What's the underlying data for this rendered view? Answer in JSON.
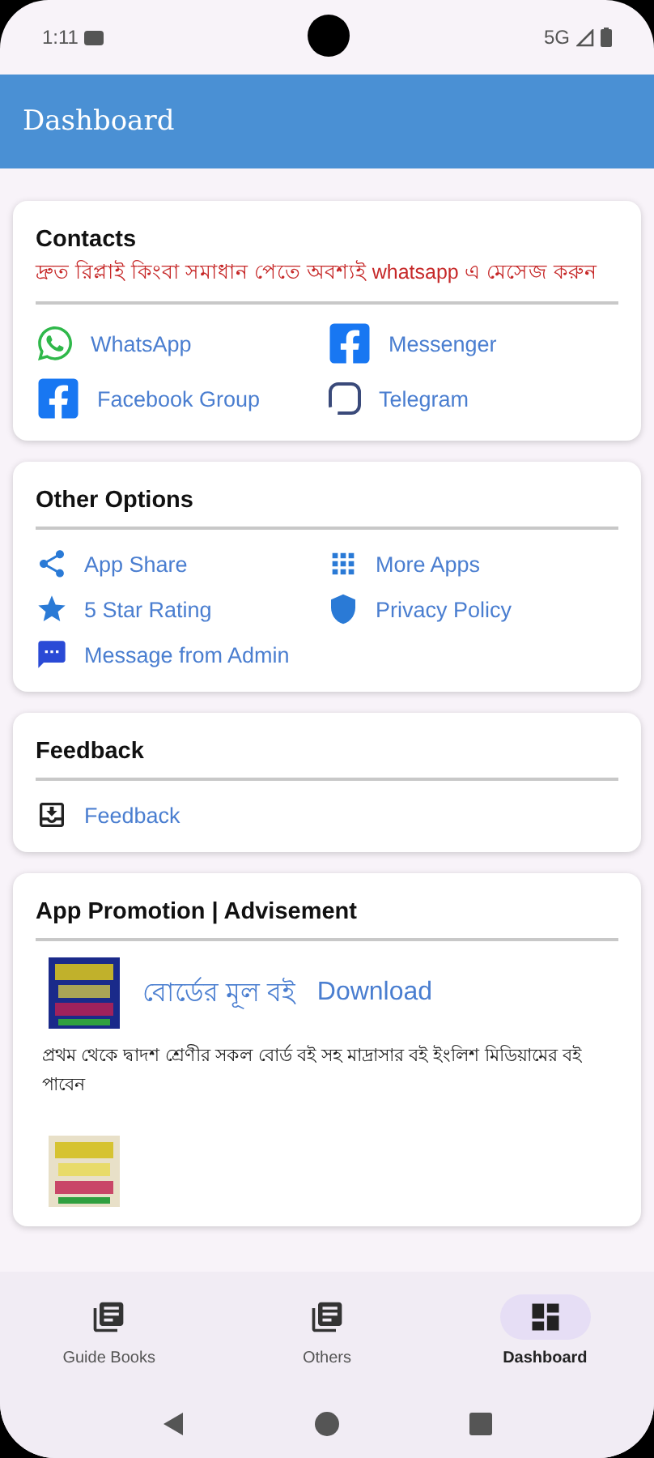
{
  "status_bar": {
    "time": "1:11",
    "network": "5G"
  },
  "app_bar": {
    "title": "Dashboard"
  },
  "contacts": {
    "title": "Contacts",
    "note": "দ্রুত রিপ্লাই কিংবা সমাধান পেতে অবশ্যই whatsapp এ মেসেজ করুন",
    "items": [
      {
        "label": "WhatsApp",
        "kind": "whatsapp"
      },
      {
        "label": "Messenger",
        "kind": "facebook"
      },
      {
        "label": "Facebook Group",
        "kind": "facebook"
      },
      {
        "label": "Telegram",
        "kind": "telegram"
      }
    ]
  },
  "other_options": {
    "title": "Other Options",
    "items": [
      {
        "label": "App Share",
        "kind": "share"
      },
      {
        "label": "More Apps",
        "kind": "grid"
      },
      {
        "label": "5 Star Rating",
        "kind": "star"
      },
      {
        "label": "Privacy Policy",
        "kind": "shield"
      },
      {
        "label": "Message from Admin",
        "kind": "message"
      }
    ]
  },
  "feedback": {
    "title": "Feedback",
    "items": [
      {
        "label": "Feedback",
        "kind": "feedback"
      }
    ]
  },
  "promotion": {
    "title": "App Promotion | Advisement",
    "apps": [
      {
        "kind": "full",
        "name": "বোর্ডের মূল বই",
        "action": "Download",
        "description": "প্রথম থেকে দ্বাদশ শ্রেণীর সকল বোর্ড বই সহ মাদ্রাসার বই ইংলিশ মিডিয়ামের বই পাবেন"
      },
      {
        "kind": "cut"
      }
    ]
  },
  "bottom_nav": [
    {
      "label": "Guide Books",
      "kind": "books",
      "selected": false
    },
    {
      "label": "Others",
      "kind": "books",
      "selected": false
    },
    {
      "label": "Dashboard",
      "kind": "dashboard",
      "selected": true
    }
  ]
}
